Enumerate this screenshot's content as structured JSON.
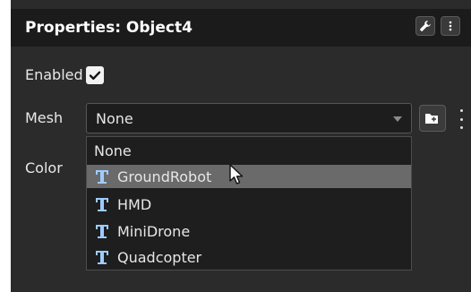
{
  "header": {
    "title": "Properties: Object4"
  },
  "fields": {
    "enabled_label": "Enabled",
    "mesh_label": "Mesh",
    "mesh_value": "None",
    "color_label": "Color"
  },
  "dropdown": {
    "options": [
      {
        "label": "None",
        "icon": ""
      },
      {
        "label": "GroundRobot",
        "icon": "mesh-asset-icon"
      },
      {
        "label": "HMD",
        "icon": "mesh-asset-icon"
      },
      {
        "label": "MiniDrone",
        "icon": "mesh-asset-icon"
      },
      {
        "label": "Quadcopter",
        "icon": "mesh-asset-icon"
      }
    ],
    "hovered_index": 1
  },
  "colors": {
    "panel_bg": "#2b2b2b",
    "header_bg": "#1b1b1b",
    "hover_bg": "#6a6a6a",
    "icon_color": "#9ecbff"
  }
}
